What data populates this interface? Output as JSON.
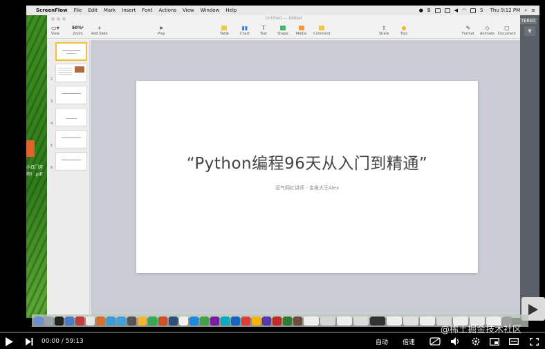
{
  "menubar": {
    "app_name": "ScreenFlow",
    "items": [
      "File",
      "Edit",
      "Mark",
      "Insert",
      "Font",
      "Actions",
      "View",
      "Window",
      "Help"
    ],
    "status_letter_b": "B",
    "status_letter_s": "S",
    "clock": "Thu 9:12 PM"
  },
  "window": {
    "title": "Untitled — Edited"
  },
  "toolbar": {
    "view_label": "View",
    "zoom_value": "50%",
    "zoom_label": "Zoom",
    "add_slide_label": "Add Slide",
    "play_label": "Play",
    "table_label": "Table",
    "chart_label": "Chart",
    "text_label": "Text",
    "shape_label": "Shape",
    "media_label": "Media",
    "comment_label": "Comment",
    "share_label": "Share",
    "tips_label": "Tips",
    "format_label": "Format",
    "animate_label": "Animate",
    "document_label": "Document"
  },
  "slides_panel": {
    "numbers": [
      "2",
      "3",
      "4",
      "5",
      "6"
    ]
  },
  "slide": {
    "title": "“Python编程96天从入门到精通”",
    "subtitle": "逗气网红讲师 - 金角大王Alex"
  },
  "right_panel": {
    "label": "TERED"
  },
  "desktop": {
    "label1": "小白门咨",
    "label2": "师）.pdf"
  },
  "watermark": "@稀土掘金技术社区",
  "player": {
    "current_time": "00:00",
    "separator": "/",
    "duration": "59:13",
    "progress": 0.0,
    "autoplay_label": "自动",
    "speed_label": "倍速"
  },
  "colors": {
    "accent": "#ff0000",
    "slide_title": "#444444",
    "canvas_bg": "#c9cdd3",
    "selected_slide_border": "#f0c23a"
  }
}
